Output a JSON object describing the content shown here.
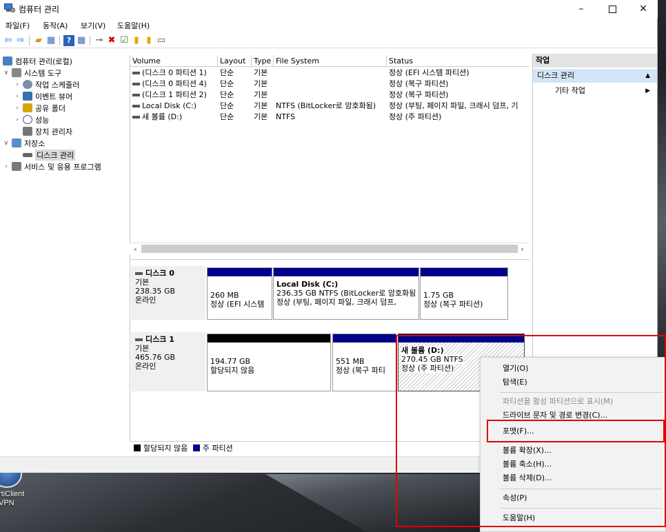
{
  "window": {
    "title": "컴퓨터 관리",
    "minimize": "–",
    "close": "✕"
  },
  "menubar": [
    "파일(F)",
    "동작(A)",
    "보기(V)",
    "도움말(H)"
  ],
  "tree": {
    "root": "컴퓨터 관리(로컬)",
    "system_tools": "시스템 도구",
    "task_scheduler": "작업 스케줄러",
    "event_viewer": "이벤트 뷰어",
    "shared_folders": "공유 폴더",
    "performance": "성능",
    "device_manager": "장치 관리자",
    "storage": "저장소",
    "disk_management": "디스크 관리",
    "services_apps": "서비스 및 응용 프로그램"
  },
  "volume_table": {
    "headers": [
      "Volume",
      "Layout",
      "Type",
      "File System",
      "Status"
    ],
    "rows": [
      [
        "(디스크 0 파티션 1)",
        "단순",
        "기본",
        "",
        "정상 (EFI 시스템 파티션)"
      ],
      [
        "(디스크 0 파티션 4)",
        "단순",
        "기본",
        "",
        "정상 (복구 파티션)"
      ],
      [
        "(디스크 1 파티션 2)",
        "단순",
        "기본",
        "",
        "정상 (복구 파티션)"
      ],
      [
        "Local Disk (C:)",
        "단순",
        "기본",
        "NTFS (BitLocker로 암호화됨)",
        "정상 (부팅, 페이지 파일, 크래시 덤프, 기"
      ],
      [
        "새 볼륨 (D:)",
        "단순",
        "기본",
        "NTFS",
        "정상 (주 파티션)"
      ]
    ]
  },
  "disks": [
    {
      "name": "디스크 0",
      "lines": [
        "기본",
        "238.35 GB",
        "온라인"
      ],
      "partitions": [
        {
          "title": "",
          "size": "260 MB",
          "status": "정상 (EFI 시스템"
        },
        {
          "title": "Local Disk  (C:)",
          "size": "236.35 GB NTFS (BitLocker로 암호화됨",
          "status": "정상 (부팅, 페이지 파일, 크래시 덤프,"
        },
        {
          "title": "",
          "size": "1.75 GB",
          "status": "정상 (복구 파티션)"
        }
      ]
    },
    {
      "name": "디스크 1",
      "lines": [
        "기본",
        "465.76 GB",
        "온라인"
      ],
      "partitions": [
        {
          "title": "",
          "size": "194.77 GB",
          "status": "할당되지 않음"
        },
        {
          "title": "",
          "size": "551 MB",
          "status": "정상 (복구 파티"
        },
        {
          "title": "새 볼륨  (D:)",
          "size": "270.45 GB NTFS",
          "status": "정상 (주 파티션)"
        }
      ]
    }
  ],
  "legend": {
    "unallocated": "할당되지 않음",
    "primary": "주 파티션"
  },
  "actions": {
    "header": "작업",
    "section": "디스크 관리",
    "more": "기타 작업"
  },
  "context_menu": {
    "open": "열기(O)",
    "explore": "탐색(E)",
    "mark_active": "파티션을 활성 파티션으로 표시(M)",
    "change_letter": "드라이브 문자 및 경로 변경(C)...",
    "format": "포맷(F)...",
    "extend": "볼륨 확장(X)...",
    "shrink": "볼륨 축소(H)...",
    "delete": "볼륨 삭제(D)...",
    "properties": "속성(P)",
    "help": "도움말(H)"
  },
  "desktop": {
    "shortcut_label_1": "rtiClient",
    "shortcut_label_2": "VPN"
  },
  "colors": {
    "primary_partition": "#00008b",
    "unallocated": "#000000",
    "highlight": "#e00000",
    "selection": "#d4e4f7"
  },
  "icons": [
    "back-arrow-icon",
    "forward-arrow-icon",
    "up-folder-icon",
    "properties-icon",
    "help-icon",
    "delete-icon",
    "check-icon",
    "folder-icon",
    "computer-management-icon"
  ]
}
